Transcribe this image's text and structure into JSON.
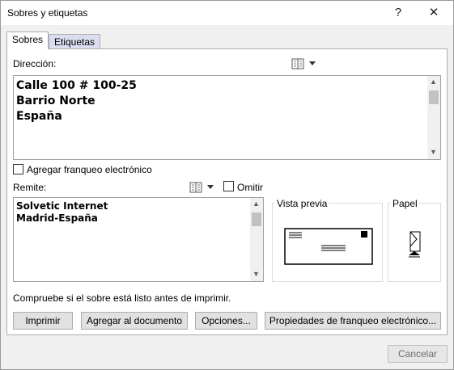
{
  "window": {
    "title": "Sobres y etiquetas",
    "help_glyph": "?",
    "close_glyph": "✕"
  },
  "tabs": [
    {
      "label": "Sobres",
      "active": true
    },
    {
      "label": "Etiquetas",
      "active": false
    }
  ],
  "address": {
    "label": "Dirección:",
    "text": "Calle 100 # 100-25\nBarrio Norte\nEspaña"
  },
  "e_postage": {
    "label": "Agregar franqueo electrónico",
    "checked": false
  },
  "return_address": {
    "label": "Remite:",
    "omit_label": "Omitir",
    "omit_checked": false,
    "text": "Solvetic Internet\nMadrid-España"
  },
  "preview": {
    "label": "Vista previa"
  },
  "paper": {
    "label": "Papel"
  },
  "note": "Compruebe si el sobre está listo antes de imprimir.",
  "buttons": {
    "print": "Imprimir",
    "add_to_document": "Agregar al documento",
    "options": "Opciones...",
    "epostage_props": "Propiedades de franqueo electrónico...",
    "cancel": "Cancelar"
  },
  "icons": {
    "address_book": "address-book-icon",
    "dropdown": "chevron-down-icon"
  }
}
